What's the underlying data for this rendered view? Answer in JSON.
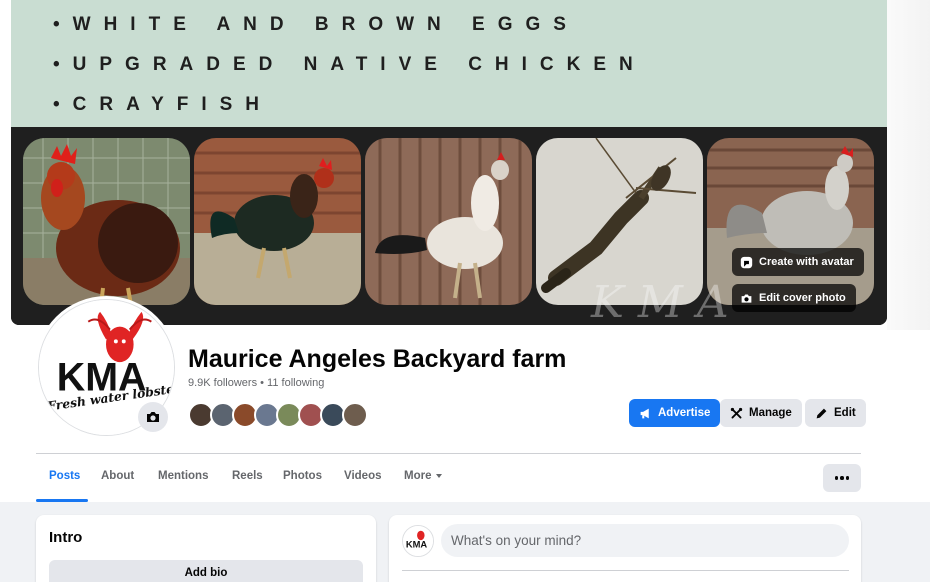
{
  "cover": {
    "lines": [
      "•WHITE AND BROWN EGGS",
      "•UPGRADED NATIVE CHICKEN",
      "•CRAYFISH"
    ],
    "watermark": "KMA",
    "create_avatar_label": "Create with avatar",
    "edit_cover_label": "Edit cover photo"
  },
  "profile": {
    "logo_text": "KMA",
    "logo_tagline": "Fresh water lobster",
    "name": "Maurice Angeles Backyard farm",
    "stats": "9.9K followers • 11 following",
    "follower_avatar_count": 8
  },
  "actions": {
    "advertise": "Advertise",
    "manage": "Manage",
    "edit": "Edit"
  },
  "tabs": [
    "Posts",
    "About",
    "Mentions",
    "Reels",
    "Photos",
    "Videos",
    "More"
  ],
  "intro": {
    "title": "Intro",
    "add_bio": "Add bio"
  },
  "composer": {
    "placeholder": "What's on your mind?"
  },
  "colors": {
    "accent": "#1877f2",
    "cover_banner": "#c9ddd2",
    "button_grey": "#e4e6eb"
  }
}
